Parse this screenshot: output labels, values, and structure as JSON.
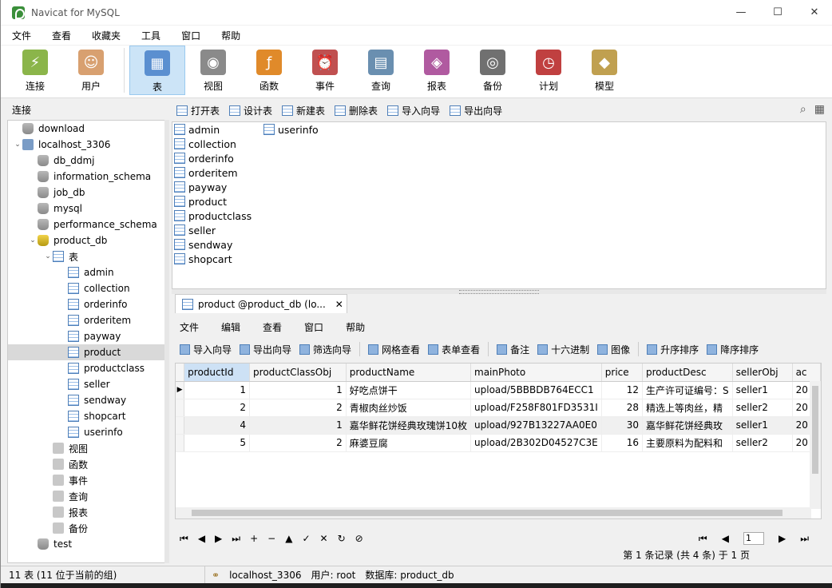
{
  "window": {
    "title": "Navicat for MySQL",
    "controls": [
      "—",
      "☐",
      "✕"
    ]
  },
  "menubar": [
    "文件",
    "查看",
    "收藏夹",
    "工具",
    "窗口",
    "帮助"
  ],
  "toolbar": [
    {
      "label": "连接",
      "icon": "connection-icon",
      "color": "#8bb54a"
    },
    {
      "label": "用户",
      "icon": "user-icon",
      "color": "#d8a070"
    },
    {
      "label": "表",
      "icon": "table-icon",
      "color": "#5b8fd0",
      "active": true
    },
    {
      "label": "视图",
      "icon": "view-icon",
      "color": "#8a8a8a"
    },
    {
      "label": "函数",
      "icon": "function-icon",
      "color": "#e08a2a"
    },
    {
      "label": "事件",
      "icon": "event-icon",
      "color": "#c05050"
    },
    {
      "label": "查询",
      "icon": "query-icon",
      "color": "#6a8fb0"
    },
    {
      "label": "报表",
      "icon": "report-icon",
      "color": "#b05aa0"
    },
    {
      "label": "备份",
      "icon": "backup-icon",
      "color": "#707070"
    },
    {
      "label": "计划",
      "icon": "schedule-icon",
      "color": "#c04040"
    },
    {
      "label": "模型",
      "icon": "model-icon",
      "color": "#c0a050"
    }
  ],
  "left_header": "连接",
  "tree": [
    {
      "label": "download",
      "icon": "db",
      "indent": 0,
      "toggle": ""
    },
    {
      "label": "localhost_3306",
      "icon": "conn",
      "indent": 0,
      "toggle": "v"
    },
    {
      "label": "db_ddmj",
      "icon": "db",
      "indent": 1,
      "toggle": ""
    },
    {
      "label": "information_schema",
      "icon": "db",
      "indent": 1,
      "toggle": ""
    },
    {
      "label": "job_db",
      "icon": "db",
      "indent": 1,
      "toggle": ""
    },
    {
      "label": "mysql",
      "icon": "db",
      "indent": 1,
      "toggle": ""
    },
    {
      "label": "performance_schema",
      "icon": "db",
      "indent": 1,
      "toggle": ""
    },
    {
      "label": "product_db",
      "icon": "dbopen",
      "indent": 1,
      "toggle": "v"
    },
    {
      "label": "表",
      "icon": "tbl",
      "indent": 2,
      "toggle": "v"
    },
    {
      "label": "admin",
      "icon": "tbl",
      "indent": 3,
      "toggle": ""
    },
    {
      "label": "collection",
      "icon": "tbl",
      "indent": 3,
      "toggle": ""
    },
    {
      "label": "orderinfo",
      "icon": "tbl",
      "indent": 3,
      "toggle": ""
    },
    {
      "label": "orderitem",
      "icon": "tbl",
      "indent": 3,
      "toggle": ""
    },
    {
      "label": "payway",
      "icon": "tbl",
      "indent": 3,
      "toggle": ""
    },
    {
      "label": "product",
      "icon": "tbl",
      "indent": 3,
      "toggle": "",
      "selected": true
    },
    {
      "label": "productclass",
      "icon": "tbl",
      "indent": 3,
      "toggle": ""
    },
    {
      "label": "seller",
      "icon": "tbl",
      "indent": 3,
      "toggle": ""
    },
    {
      "label": "sendway",
      "icon": "tbl",
      "indent": 3,
      "toggle": ""
    },
    {
      "label": "shopcart",
      "icon": "tbl",
      "indent": 3,
      "toggle": ""
    },
    {
      "label": "userinfo",
      "icon": "tbl",
      "indent": 3,
      "toggle": ""
    },
    {
      "label": "视图",
      "icon": "misc",
      "indent": 2,
      "toggle": ""
    },
    {
      "label": "函数",
      "icon": "misc",
      "indent": 2,
      "toggle": ""
    },
    {
      "label": "事件",
      "icon": "misc",
      "indent": 2,
      "toggle": ""
    },
    {
      "label": "查询",
      "icon": "misc",
      "indent": 2,
      "toggle": ""
    },
    {
      "label": "报表",
      "icon": "misc",
      "indent": 2,
      "toggle": ""
    },
    {
      "label": "备份",
      "icon": "misc",
      "indent": 2,
      "toggle": ""
    },
    {
      "label": "test",
      "icon": "db",
      "indent": 1,
      "toggle": ""
    }
  ],
  "object_toolbar": [
    "打开表",
    "设计表",
    "新建表",
    "删除表",
    "导入向导",
    "导出向导"
  ],
  "object_list": [
    "admin",
    "collection",
    "orderinfo",
    "orderitem",
    "payway",
    "product",
    "productclass",
    "seller",
    "sendway",
    "shopcart",
    "userinfo"
  ],
  "data_tab": {
    "title": "product @product_db (lo...",
    "close": "✕"
  },
  "data_menu": [
    "文件",
    "编辑",
    "查看",
    "窗口",
    "帮助"
  ],
  "data_tools": [
    "导入向导",
    "导出向导",
    "筛选向导",
    "网格查看",
    "表单查看",
    "备注",
    "十六进制",
    "图像",
    "升序排序",
    "降序排序"
  ],
  "grid": {
    "columns": [
      "productId",
      "productClassObj",
      "productName",
      "mainPhoto",
      "price",
      "productDesc",
      "sellerObj",
      "ac"
    ],
    "rows": [
      [
        "1",
        "1",
        "好吃点饼干",
        "upload/5BBBDB764ECC1",
        "12",
        "生产许可证编号：S",
        "seller1",
        "20"
      ],
      [
        "2",
        "2",
        "青椒肉丝炒饭",
        "upload/F258F801FD3531I",
        "28",
        "精选上等肉丝，精",
        "seller2",
        "20"
      ],
      [
        "4",
        "1",
        "嘉华鲜花饼经典玫瑰饼10枚",
        "upload/927B13227AA0E0",
        "30",
        "嘉华鲜花饼经典玫",
        "seller1",
        "20"
      ],
      [
        "5",
        "2",
        "麻婆豆腐",
        "upload/2B302D04527C3E",
        "16",
        "主要原料为配料和",
        "seller2",
        "20"
      ]
    ]
  },
  "nav": {
    "buttons": [
      "⏮",
      "◀",
      "▶",
      "⏭",
      "+",
      "−",
      "▲",
      "✓",
      "✕",
      "↻",
      "⊘"
    ],
    "right_buttons": [
      "⏮",
      "◀",
      "▶",
      "⏭"
    ],
    "page": "1",
    "record_status": "第 1 条记录 (共 4 条) 于 1 页"
  },
  "statusbar": {
    "left": "11 表 (11 位于当前的组)",
    "connection": "localhost_3306",
    "user": "用户: root",
    "database": "数据库: product_db"
  }
}
